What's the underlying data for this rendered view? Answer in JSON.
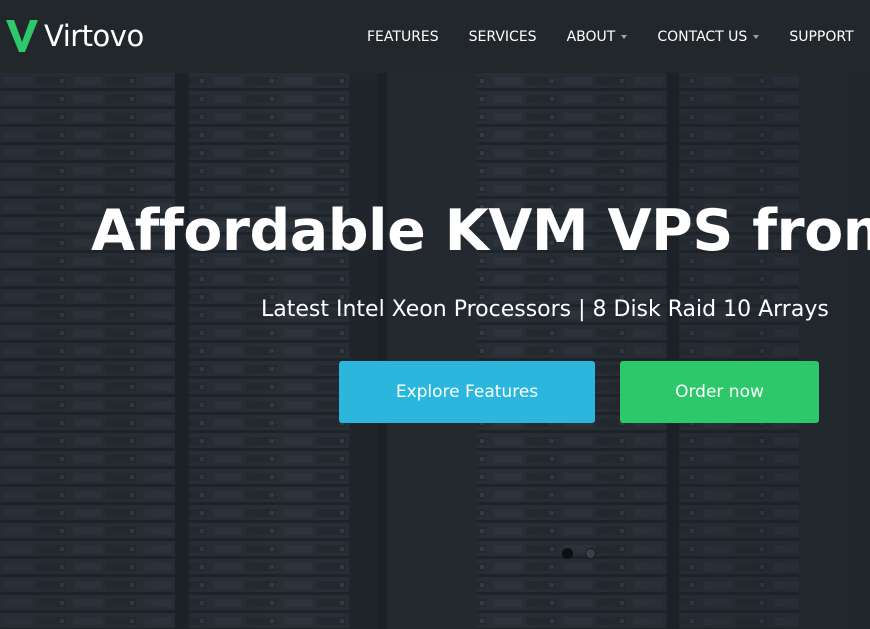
{
  "brand": {
    "name": "Virtovo",
    "accent_color": "#2cc86a"
  },
  "nav": {
    "items": [
      {
        "label": "FEATURES",
        "dropdown": false
      },
      {
        "label": "SERVICES",
        "dropdown": false
      },
      {
        "label": "ABOUT",
        "dropdown": true
      },
      {
        "label": "CONTACT US",
        "dropdown": true
      },
      {
        "label": "SUPPORT",
        "dropdown": false
      }
    ]
  },
  "hero": {
    "title": "Affordable KVM VPS from $",
    "subtitle": "Latest Intel Xeon Processors | 8 Disk Raid 10 Arrays",
    "buttons": {
      "explore": {
        "label": "Explore Features",
        "color": "#2bb6de"
      },
      "order": {
        "label": "Order now",
        "color": "#2cc86a"
      }
    },
    "slider": {
      "slide_count": 2,
      "active_slide": 1
    }
  }
}
